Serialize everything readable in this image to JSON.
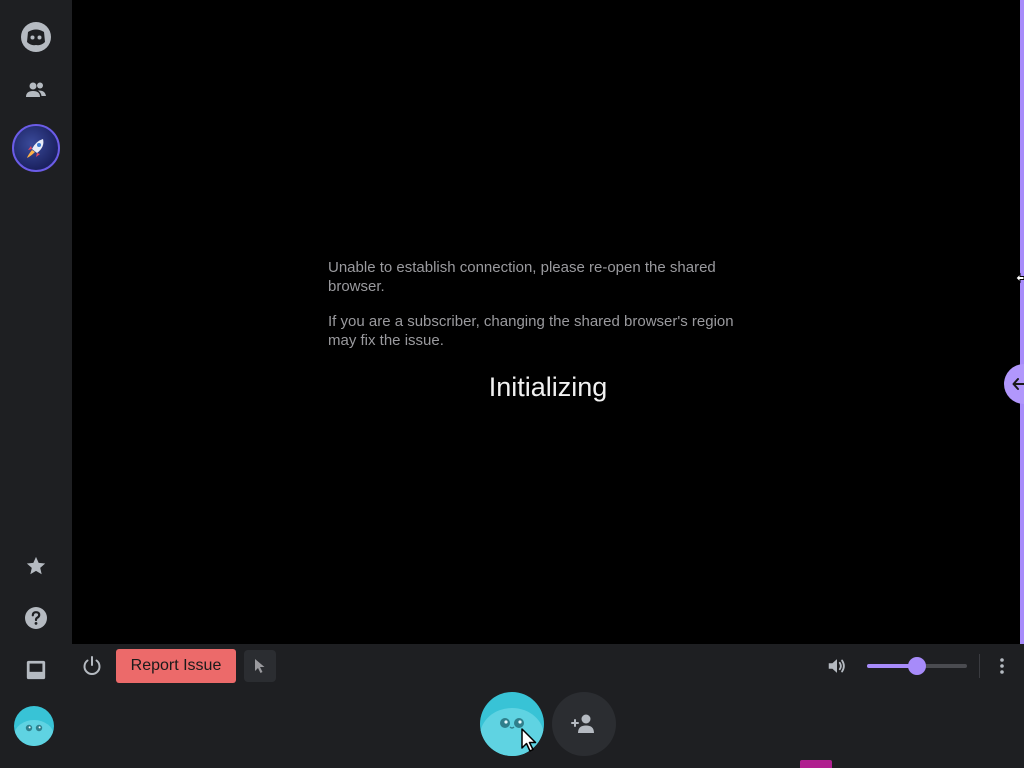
{
  "sidebar": {
    "items": [
      {
        "name": "discord-logo-icon"
      },
      {
        "name": "friends-icon"
      },
      {
        "name": "app-launcher-avatar"
      },
      {
        "name": "star-icon"
      },
      {
        "name": "help-icon"
      },
      {
        "name": "inbox-icon"
      },
      {
        "name": "user-avatar"
      }
    ]
  },
  "main": {
    "error_line_1": "Unable to establish connection, please re-open the shared browser.",
    "error_line_2": "If you are a subscriber, changing the shared browser's region may fix the issue.",
    "status": "Initializing"
  },
  "controls": {
    "report_label": "Report Issue",
    "volume_level": 0.5
  },
  "colors": {
    "accent": "#a78bfa",
    "report_button": "#ec6a6a",
    "panel": "#1e1f22",
    "avatar": "#38c3d6"
  }
}
